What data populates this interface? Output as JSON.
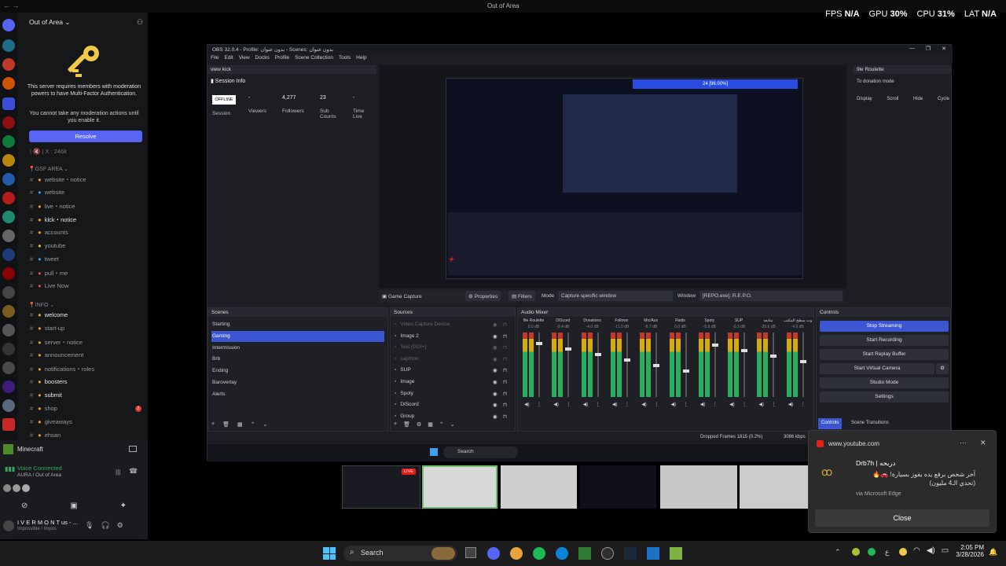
{
  "window": {
    "title": "Out of Area"
  },
  "stats": {
    "fps_label": "FPS",
    "fps": "N/A",
    "gpu_label": "GPU",
    "gpu": "30%",
    "cpu_label": "CPU",
    "cpu": "31%",
    "lat_label": "LAT",
    "lat": "N/A"
  },
  "discord": {
    "server_name": "Out of Area",
    "mfa_title": "This server requires members with moderation powers to have Multi-Factor Authentication.",
    "mfa_sub": "You cannot take any moderation actions until you enable it.",
    "resolve": "Resolve",
    "count_line": "| 🔇 | X : 246k",
    "categories": [
      "GSF AREA",
      "INFO"
    ],
    "channels_a": [
      "website・notice",
      "website",
      "live・notice",
      "kick・notice",
      "accounts",
      "youtube",
      "tweet",
      "pull・me",
      "Live Now"
    ],
    "channels_b": [
      "welcome",
      "start-up",
      "server・notice",
      "announcement",
      "notifications・roles",
      "boosters",
      "submit",
      "shop",
      "giveaways",
      "ehsan"
    ],
    "submit_badge": "2",
    "game": "Minecraft",
    "voice_connected": "Voice Connected",
    "voice_server": "AURA / Out of Area",
    "user": "I V E R M O N T us - ...",
    "user_status": "Impossible / Impos"
  },
  "obs": {
    "title": "OBS 32.0.4 - Profile: بدون عنوان - Scenes: بدون عنوان",
    "menu": [
      "File",
      "Edit",
      "View",
      "Docks",
      "Profile",
      "Scene Collection",
      "Tools",
      "Help"
    ],
    "kick_dock": "view kick",
    "session_info": "Session Info",
    "session": {
      "status": "OFFLINE",
      "status_label": "Session",
      "viewers": "-",
      "viewers_label": "Viewers",
      "followers": "4,277",
      "followers_label": "Followers",
      "subs": "23",
      "subs_label": "Sub Counts",
      "time": "-",
      "time_label": "Time Live"
    },
    "roulette_dock": "9le Roulette",
    "roulette_btn": "To donation mode",
    "roulette_actions": [
      "Display",
      "Scroll",
      "Hide",
      "Cycle"
    ],
    "source_bar": {
      "name": "Game Capture",
      "properties": "Properties",
      "filters": "Filters",
      "mode_label": "Mode",
      "mode": "Capture specific window",
      "window_label": "Window",
      "window": "[REPO.exe]: R.E.P.O."
    },
    "preview_bar": "24 [96.00%]",
    "scenes_title": "Scenes",
    "scenes": [
      "Starting",
      "Gaming",
      "Intermission",
      "Brb",
      "Ending",
      "Baroverlay",
      "Alerts"
    ],
    "sources_title": "Sources",
    "sources": [
      "Video Capture Device",
      "Image 2",
      "Text (GDI+)",
      "sapthon",
      "SUP",
      "Image",
      "Spoty",
      "DIScord",
      "Group"
    ],
    "mixer_title": "Audio Mixer",
    "mixer_channels": [
      "9le Roulette",
      "DIScord",
      "Donations",
      "Follows",
      "Mic/Aux",
      "Raids",
      "Spoty",
      "SUP",
      "متابعة",
      "صوت سطح المكتب"
    ],
    "mixer_db": [
      "0.0 dB",
      "-9.4 dB",
      "-4.0 dB",
      "-11.0 dB",
      "-6.7 dB",
      "0.0 dB",
      "-5.9 dB",
      "-5.3 dB",
      "-20.6 dB",
      "-4.6 dB"
    ],
    "controls_title": "Controls",
    "controls": [
      "Stop Streaming",
      "Start Recording",
      "Start Replay Buffer",
      "Start Virtual Camera",
      "Studio Mode",
      "Settings"
    ],
    "bottom_tabs": [
      "Controls",
      "Scene Transitions"
    ],
    "status": "Dropped Frames 1815 (0.2%)",
    "bitrate": "3086 kbps"
  },
  "taskbar": {
    "search": "Search",
    "time": "2:05 PM",
    "date": "3/28/2026",
    "lang": "ع"
  },
  "live_badge": "LIVE",
  "inner_search": "Search",
  "toast": {
    "source": "www.youtube.com",
    "title": "Drb7h | دربحه",
    "body": "آخر شخص برفع يده يفوز بسيارة! 🚗🔥 (تحدي الـ4 مليون)",
    "via": "via Microsoft Edge",
    "close": "Close"
  }
}
